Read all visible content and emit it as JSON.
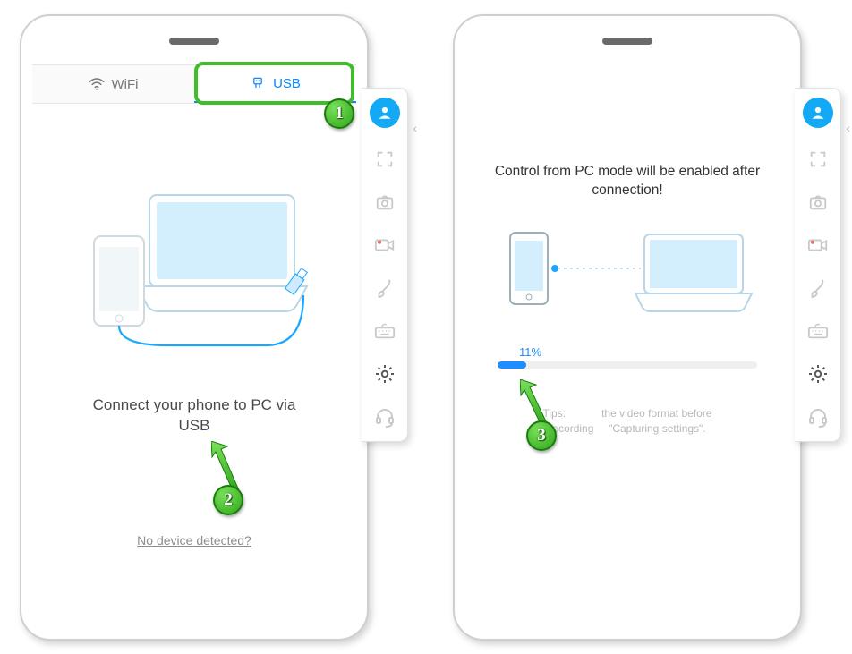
{
  "panel_left": {
    "tabs": {
      "wifi": "WiFi",
      "usb": "USB"
    },
    "message": "Connect your phone to PC via USB",
    "no_device_link": "No device detected?"
  },
  "panel_right": {
    "heading": "Control from PC mode will be enabled after connection!",
    "progress_percent_label": "11%",
    "progress_percent_value": 11,
    "tips_line1": "Tips:",
    "tips_line2": "the video format before recording",
    "tips_line3": "\"Capturing settings\"."
  },
  "side_rail": {
    "items": [
      "avatar",
      "fullscreen",
      "camera",
      "record",
      "brush",
      "keyboard",
      "settings",
      "headset"
    ]
  },
  "step_badges": {
    "one": "1",
    "two": "2",
    "three": "3"
  },
  "colors": {
    "accent": "#1f8cff",
    "highlight_green": "#3fbd2b"
  }
}
